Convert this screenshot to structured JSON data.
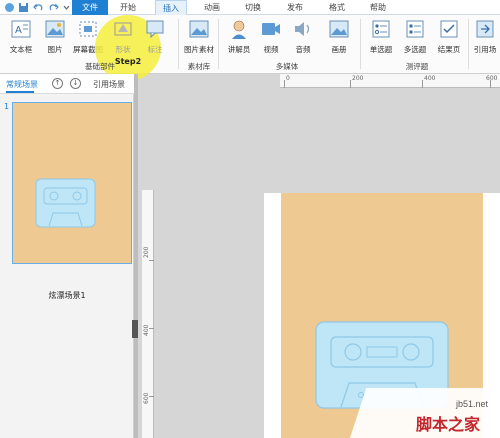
{
  "menubar": {
    "tabs": [
      "文件",
      "开始",
      "插入",
      "动画",
      "切换",
      "发布",
      "格式",
      "帮助"
    ],
    "active_tab": "插入"
  },
  "ribbon": {
    "buttons": [
      "文本框",
      "图片",
      "屏幕截图",
      "形状",
      "标注",
      "图片素材",
      "讲解员",
      "视频",
      "音频",
      "画册",
      "单选题",
      "多选题",
      "结果页",
      "引用场"
    ],
    "groups": [
      "基础部件",
      "素材库",
      "多媒体",
      "测评题"
    ]
  },
  "annotation": {
    "step": "Step2",
    "color": "#f5ed3c"
  },
  "left_panel": {
    "tab_active": "常规场景",
    "tab_reference": "引用场景",
    "slide_number": "1",
    "slide_caption": "炫漂场景1"
  },
  "rulers": {
    "horizontal_labels": [
      "0",
      "200",
      "400",
      "600"
    ],
    "vertical_labels": [
      "200",
      "400",
      "600"
    ]
  },
  "watermark": {
    "site": "jb51.net",
    "brand": "脚本之家"
  },
  "colors": {
    "accent": "#1f7fd3",
    "slide_bg": "#efc992",
    "cassette": "#bfe6f7"
  }
}
